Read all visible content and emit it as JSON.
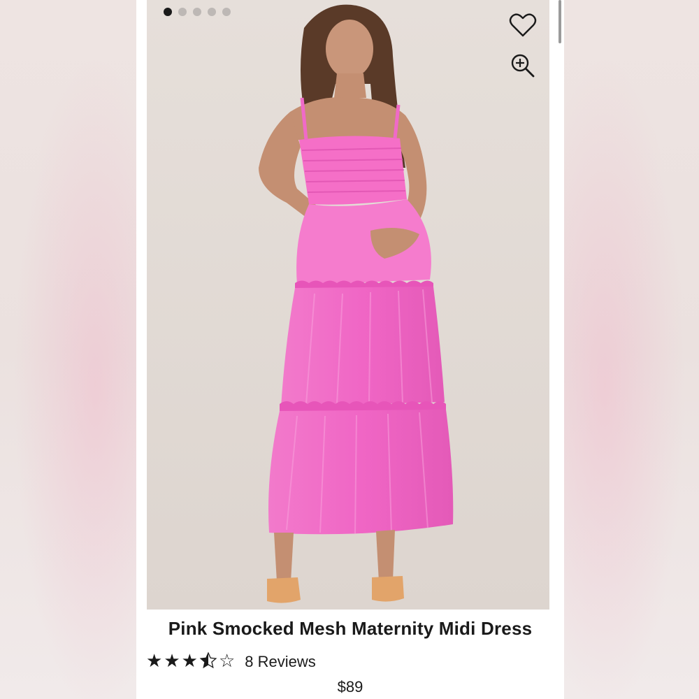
{
  "gallery": {
    "dot_count": 5,
    "active_index": 0,
    "image_alt": "Model wearing pink smocked mesh maternity midi dress"
  },
  "actions": {
    "favorite_icon": "heart-icon",
    "zoom_icon": "zoom-in-icon"
  },
  "product": {
    "title": "Pink Smocked Mesh Maternity Midi Dress",
    "rating": 3.5,
    "rating_max": 5,
    "reviews_label": "8 Reviews",
    "price": "$89"
  },
  "colors": {
    "dress_pink": "#f06ac8",
    "background": "#e2dbd6",
    "text": "#1a1a1a"
  }
}
